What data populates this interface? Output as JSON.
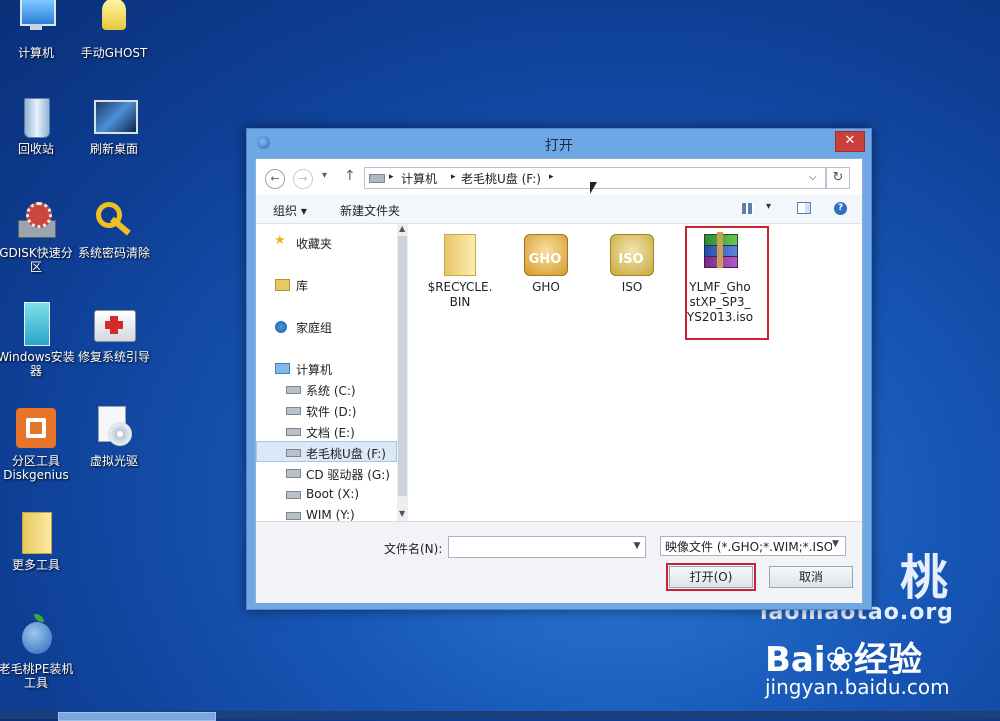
{
  "desktop": {
    "icons": [
      {
        "label": "计算机"
      },
      {
        "label": "手动GHOST"
      },
      {
        "label": "回收站"
      },
      {
        "label": "刷新桌面"
      },
      {
        "label": "GDISK快速分区"
      },
      {
        "label": "系统密码清除"
      },
      {
        "label": "Windows安装器"
      },
      {
        "label": "修复系统引导"
      },
      {
        "label": "分区工具Diskgenius"
      },
      {
        "label": "虚拟光驱"
      },
      {
        "label": "更多工具"
      },
      {
        "label": "老毛桃PE装机工具"
      }
    ],
    "watermark": {
      "brand_char": "桃",
      "site": "laomaotao.org",
      "baidu": "Bai",
      "baidu_suffix": "经验",
      "url": "jingyan.baidu.com"
    }
  },
  "dialog": {
    "title": "打开",
    "close_glyph": "✕",
    "nav": {
      "back": "←",
      "forward": "→",
      "history": "▾",
      "up": "↑"
    },
    "breadcrumb": [
      "计算机",
      "老毛桃U盘 (F:)"
    ],
    "refresh_glyph": "↻",
    "toolbar": {
      "organize": "组织 ▾",
      "new_folder": "新建文件夹"
    },
    "nav_pane": {
      "favorites": "收藏夹",
      "libraries": "库",
      "homegroup": "家庭组",
      "computer": "计算机",
      "drives": [
        "系统 (C:)",
        "软件 (D:)",
        "文档 (E:)",
        "老毛桃U盘 (F:)",
        "CD 驱动器 (G:)",
        "Boot (X:)",
        "WIM (Y:)"
      ]
    },
    "files": [
      {
        "name": "$RECYCLE.BIN",
        "line1": "$RECYCLE.",
        "line2": "BIN"
      },
      {
        "name": "GHO",
        "badge": "GHO"
      },
      {
        "name": "ISO",
        "badge": "ISO"
      },
      {
        "name": "YLMF_GhostXP_SP3_YS2013.iso",
        "line1": "YLMF_Gho",
        "line2": "stXP_SP3_",
        "line3": "YS2013.iso"
      }
    ],
    "footer": {
      "filename_label": "文件名(N):",
      "filename_value": "",
      "filetype": "映像文件 (*.GHO;*.WIM;*.ISO",
      "open_button": "打开(O)",
      "cancel_button": "取消"
    }
  }
}
